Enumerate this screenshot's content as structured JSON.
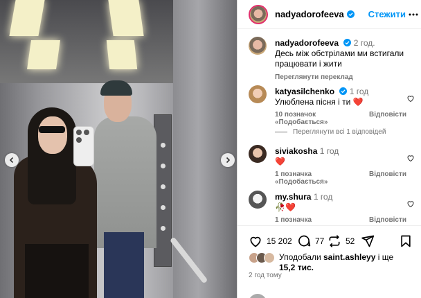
{
  "post": {
    "username": "nadyadorofeeva",
    "follow_label": "Стежити",
    "caption_time": "2 год.",
    "caption_text": "Десь між обстрілами ми встигали працювати і жити",
    "translate_label": "Переглянути переклад"
  },
  "comments": [
    {
      "username": "katyasilchenko",
      "verified": true,
      "time": "1 год",
      "text": "Улюблена пісня і ти ❤️",
      "likes": "10 позначок «Подобається»",
      "reply": "Відповісти"
    },
    {
      "username": "siviakosha",
      "verified": false,
      "time": "1 год",
      "text": "❤️",
      "likes": "1 позначка «Подобається»",
      "reply": "Відповісти"
    },
    {
      "username": "my.shura",
      "verified": false,
      "time": "1 год",
      "text": "🥀❤️",
      "likes": "1 позначка «Подобається»",
      "reply": "Відповісти"
    }
  ],
  "view_replies_label": "Переглянути всі 1 відповідей",
  "actions": {
    "likes_count": "15 202",
    "comments_count": "77",
    "reposts_count": "52"
  },
  "liked_by": {
    "prefix": "Уподобали",
    "user": "saint.ashleyy",
    "middle": "і ще",
    "count": "15,2 тис."
  },
  "posted_ago": "2 год тому",
  "colors": {
    "link": "#0095f6",
    "secondary_text": "#737373",
    "like_red": "#ed4956"
  },
  "icons": [
    "chevron-left-icon",
    "chevron-right-icon",
    "verified-badge-icon",
    "more-icon",
    "heart-icon",
    "comment-icon",
    "repost-icon",
    "share-icon",
    "bookmark-icon"
  ]
}
